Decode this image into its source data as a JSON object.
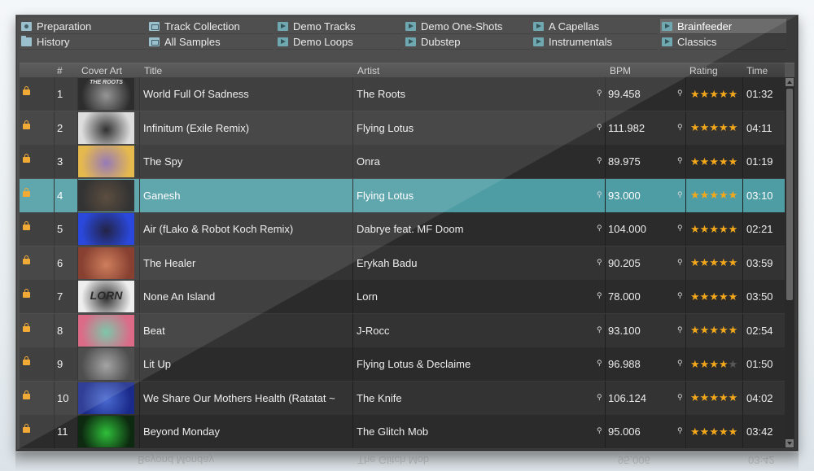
{
  "favorites": [
    {
      "label": "Preparation",
      "icon": "preparation-icon",
      "selected": false
    },
    {
      "label": "Track Collection",
      "icon": "collection-icon",
      "selected": false
    },
    {
      "label": "Demo Tracks",
      "icon": "playlist-icon",
      "selected": false
    },
    {
      "label": "Demo One-Shots",
      "icon": "playlist-icon",
      "selected": false
    },
    {
      "label": "A Capellas",
      "icon": "playlist-icon",
      "selected": false
    },
    {
      "label": "Brainfeeder",
      "icon": "playlist-icon",
      "selected": true
    },
    {
      "label": "History",
      "icon": "folder-icon",
      "selected": false
    },
    {
      "label": "All Samples",
      "icon": "collection-icon",
      "selected": false
    },
    {
      "label": "Demo Loops",
      "icon": "playlist-icon",
      "selected": false
    },
    {
      "label": "Dubstep",
      "icon": "playlist-icon",
      "selected": false
    },
    {
      "label": "Instrumentals",
      "icon": "playlist-icon",
      "selected": false
    },
    {
      "label": "Classics",
      "icon": "playlist-icon",
      "selected": false
    }
  ],
  "columns": {
    "number": "#",
    "cover": "Cover Art",
    "title": "Title",
    "artist": "Artist",
    "bpm": "BPM",
    "rating": "Rating",
    "time": "Time"
  },
  "tracks": [
    {
      "num": "1",
      "title": "World Full Of Sadness",
      "artist": "The Roots",
      "bpm": "99.458",
      "rating": 5,
      "time": "01:32",
      "cover_colors": [
        "#151515",
        "#8a8a8a"
      ]
    },
    {
      "num": "2",
      "title": "Infinitum (Exile Remix)",
      "artist": "Flying Lotus",
      "bpm": "111.982",
      "rating": 5,
      "time": "04:11",
      "cover_colors": [
        "#d9d9d9",
        "#1a1a1a"
      ]
    },
    {
      "num": "3",
      "title": "The Spy",
      "artist": "Onra",
      "bpm": "89.975",
      "rating": 5,
      "time": "01:19",
      "cover_colors": [
        "#e3b13a",
        "#8a6bb0"
      ]
    },
    {
      "num": "4",
      "title": "Ganesh",
      "artist": "Flying Lotus",
      "bpm": "93.000",
      "rating": 5,
      "time": "03:10",
      "cover_colors": [
        "#1c1c1c",
        "#4a3a2a"
      ]
    },
    {
      "num": "5",
      "title": "Air (fLako & Robot Koch Remix)",
      "artist": "Dabrye feat. MF Doom",
      "bpm": "104.000",
      "rating": 5,
      "time": "02:21",
      "cover_colors": [
        "#1234d8",
        "#0a0a30"
      ]
    },
    {
      "num": "6",
      "title": "The Healer",
      "artist": "Erykah Badu",
      "bpm": "90.205",
      "rating": 5,
      "time": "03:59",
      "cover_colors": [
        "#7a2b1a",
        "#c9704a"
      ]
    },
    {
      "num": "7",
      "title": "None An Island",
      "artist": "Lorn",
      "bpm": "78.000",
      "rating": 5,
      "time": "03:50",
      "cover_colors": [
        "#ececec",
        "#1a1a1a"
      ]
    },
    {
      "num": "8",
      "title": "Beat",
      "artist": "J-Rocc",
      "bpm": "93.100",
      "rating": 5,
      "time": "02:54",
      "cover_colors": [
        "#d85a7a",
        "#6fc0a0"
      ]
    },
    {
      "num": "9",
      "title": "Lit Up",
      "artist": "Flying Lotus & Declaime",
      "bpm": "96.988",
      "rating": 4,
      "time": "01:50",
      "cover_colors": [
        "#3a3a3a",
        "#9a9a9a"
      ]
    },
    {
      "num": "10",
      "title": "We Share Our Mothers Health (Ratatat ~",
      "artist": "The Knife",
      "bpm": "106.124",
      "rating": 5,
      "time": "04:02",
      "cover_colors": [
        "#1a2a8a",
        "#4a6ad0"
      ]
    },
    {
      "num": "11",
      "title": "Beyond Monday",
      "artist": "The Glitch Mob",
      "bpm": "95.006",
      "rating": 5,
      "time": "03:42",
      "cover_colors": [
        "#0d2a10",
        "#2fbf3a"
      ]
    }
  ],
  "cover_texts": {
    "1": "THE ROOTS",
    "7": "LORN"
  },
  "selected_track": "4",
  "colors": {
    "selection": "#4e9ca4",
    "star": "#f3a81b",
    "lock": "#f0a020"
  }
}
